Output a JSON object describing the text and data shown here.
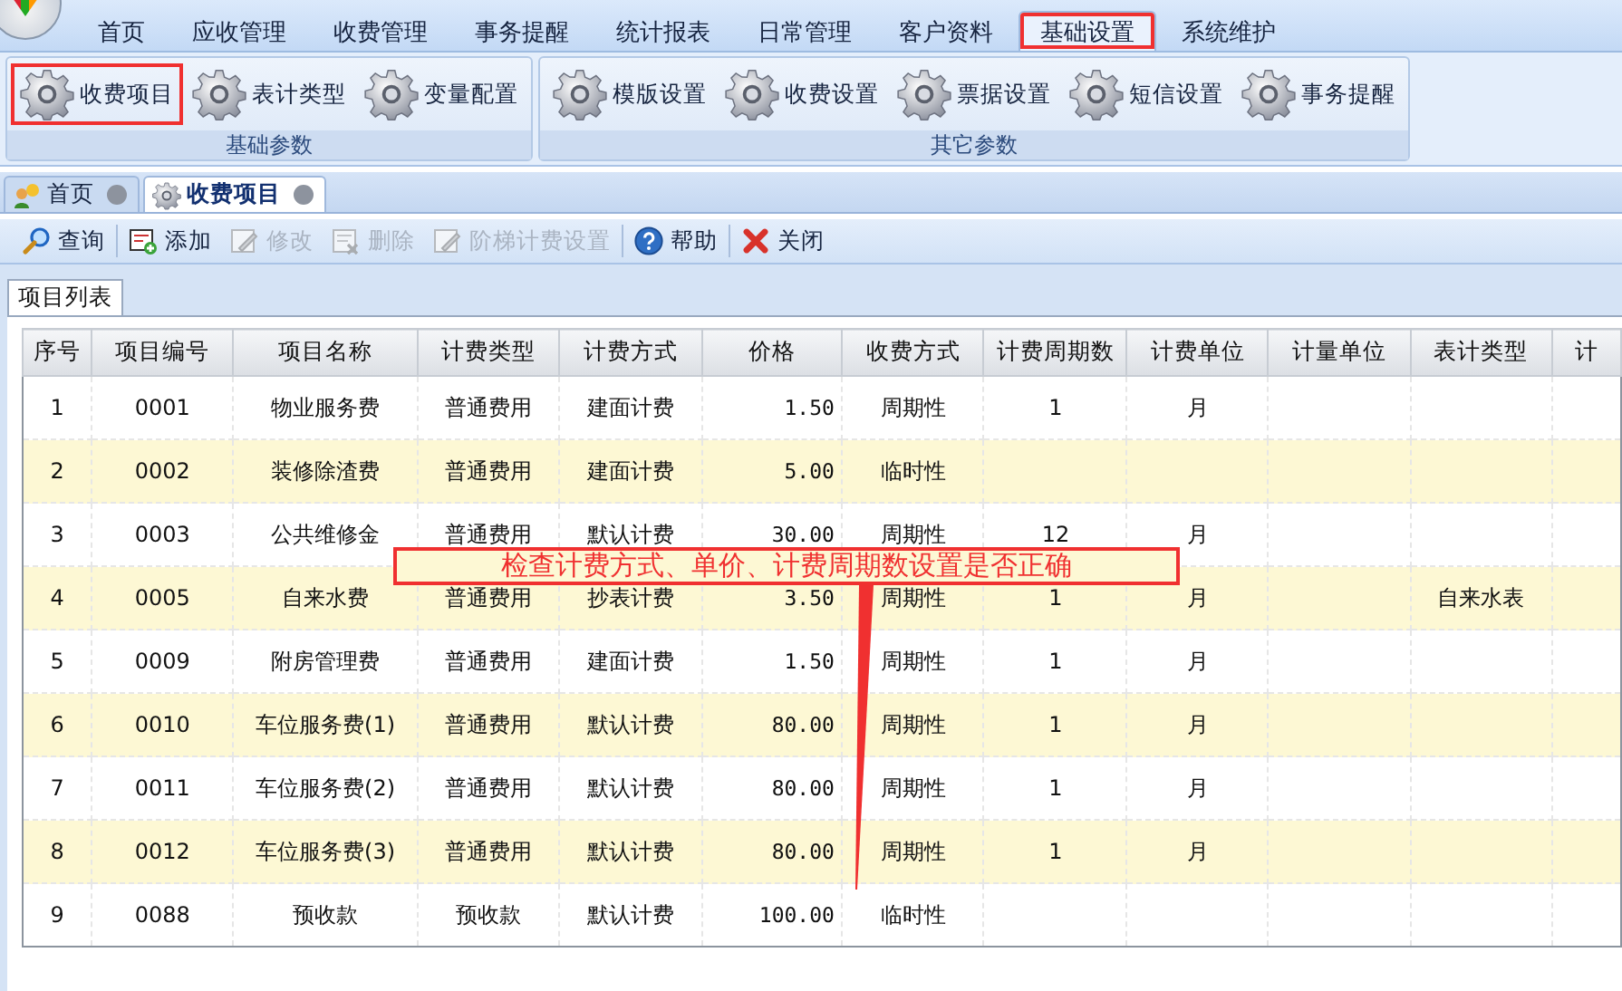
{
  "menu": [
    {
      "label": "首页",
      "selected": false,
      "annotated": false
    },
    {
      "label": "应收管理",
      "selected": false,
      "annotated": false
    },
    {
      "label": "收费管理",
      "selected": false,
      "annotated": false
    },
    {
      "label": "事务提醒",
      "selected": false,
      "annotated": false
    },
    {
      "label": "统计报表",
      "selected": false,
      "annotated": false
    },
    {
      "label": "日常管理",
      "selected": false,
      "annotated": false
    },
    {
      "label": "客户资料",
      "selected": false,
      "annotated": false
    },
    {
      "label": "基础设置",
      "selected": true,
      "annotated": true
    },
    {
      "label": "系统维护",
      "selected": false,
      "annotated": false
    }
  ],
  "ribbon_groups": [
    {
      "title": "基础参数",
      "items": [
        {
          "label": "收费项目",
          "annotated": true
        },
        {
          "label": "表计类型",
          "annotated": false
        },
        {
          "label": "变量配置",
          "annotated": false
        }
      ]
    },
    {
      "title": "其它参数",
      "items": [
        {
          "label": "模版设置",
          "annotated": false
        },
        {
          "label": "收费设置",
          "annotated": false
        },
        {
          "label": "票据设置",
          "annotated": false
        },
        {
          "label": "短信设置",
          "annotated": false
        },
        {
          "label": "事务提醒",
          "annotated": false
        }
      ]
    }
  ],
  "doc_tabs": [
    {
      "label": "首页",
      "kind": "home",
      "selected": false
    },
    {
      "label": "收费项目",
      "kind": "gear",
      "selected": true
    }
  ],
  "toolbar": [
    {
      "label": "查询",
      "kind": "search",
      "disabled": false
    },
    {
      "label": "添加",
      "kind": "add",
      "disabled": false
    },
    {
      "label": "修改",
      "kind": "edit",
      "disabled": true
    },
    {
      "label": "删除",
      "kind": "delete",
      "disabled": true
    },
    {
      "label": "阶梯计费设置",
      "kind": "edit",
      "disabled": true
    },
    {
      "label": "帮助",
      "kind": "help",
      "disabled": false
    },
    {
      "label": "关闭",
      "kind": "close",
      "disabled": false
    }
  ],
  "sub_tabs": [
    {
      "label": "项目列表",
      "selected": true
    }
  ],
  "table": {
    "columns": [
      "序号",
      "项目编号",
      "项目名称",
      "计费类型",
      "计费方式",
      "价格",
      "收费方式",
      "计费周期数",
      "计费单位",
      "计量单位",
      "表计类型",
      "计"
    ],
    "rows": [
      [
        "1",
        "0001",
        "物业服务费",
        "普通费用",
        "建面计费",
        "1.50",
        "周期性",
        "1",
        "月",
        null,
        null,
        null
      ],
      [
        "2",
        "0002",
        "装修除渣费",
        "普通费用",
        "建面计费",
        "5.00",
        "临时性",
        null,
        null,
        null,
        null,
        null
      ],
      [
        "3",
        "0003",
        "公共维修金",
        "普通费用",
        "默认计费",
        "30.00",
        "周期性",
        "12",
        "月",
        null,
        null,
        null
      ],
      [
        "4",
        "0005",
        "自来水费",
        "普通费用",
        "抄表计费",
        "3.50",
        "周期性",
        "1",
        "月",
        null,
        "自来水表",
        null
      ],
      [
        "5",
        "0009",
        "附房管理费",
        "普通费用",
        "建面计费",
        "1.50",
        "周期性",
        "1",
        "月",
        null,
        null,
        null
      ],
      [
        "6",
        "0010",
        "车位服务费(1)",
        "普通费用",
        "默认计费",
        "80.00",
        "周期性",
        "1",
        "月",
        null,
        null,
        null
      ],
      [
        "7",
        "0011",
        "车位服务费(2)",
        "普通费用",
        "默认计费",
        "80.00",
        "周期性",
        "1",
        "月",
        null,
        null,
        null
      ],
      [
        "8",
        "0012",
        "车位服务费(3)",
        "普通费用",
        "默认计费",
        "80.00",
        "周期性",
        "1",
        "月",
        null,
        null,
        null
      ],
      [
        "9",
        "0088",
        "预收款",
        "预收款",
        "默认计费",
        "100.00",
        "临时性",
        null,
        null,
        null,
        null,
        null
      ]
    ]
  },
  "callout": {
    "text": "检查计费方式、单价、计费周期数设置是否正确"
  }
}
